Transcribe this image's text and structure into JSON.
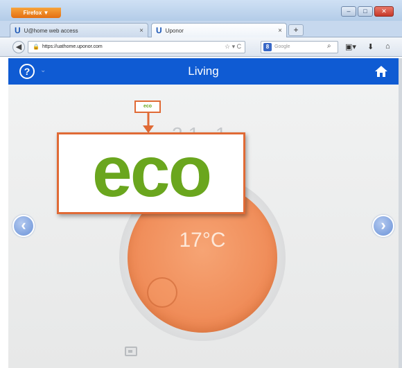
{
  "browser": {
    "app_menu_label": "Firefox ▼",
    "tabs": [
      {
        "favicon": "U",
        "label": "U@home web access",
        "close": "×"
      },
      {
        "favicon": "U",
        "label": "Uponor",
        "close": "×"
      }
    ],
    "new_tab": "+",
    "url": "https://uathome.uponor.com",
    "url_extra": "☆ ▾ C",
    "search_engine": "8",
    "search_placeholder": "Google"
  },
  "app": {
    "room_name": "Living",
    "help_symbol": "?",
    "thermostat": {
      "partial_temp": "21.1",
      "setpoint": "17°C"
    },
    "eco_badge_label": "eco",
    "eco_callout_label": "eco",
    "nav_prev": "‹",
    "nav_next": "›"
  },
  "colors": {
    "header_blue": "#0f5bd3",
    "dial_orange": "#ec7e48",
    "eco_green": "#6aa61e",
    "callout_border": "#e06a35"
  }
}
